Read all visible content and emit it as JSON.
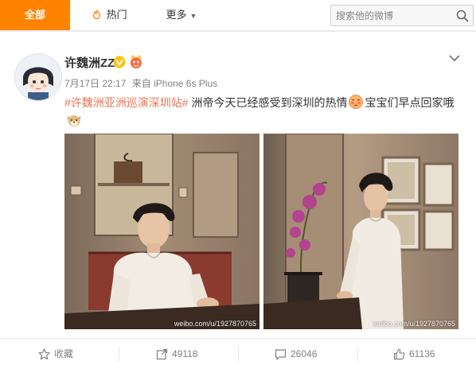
{
  "tabs": {
    "all": "全部",
    "hot": "热门",
    "more": "更多"
  },
  "search": {
    "placeholder": "搜索他的微博"
  },
  "post": {
    "username": "许魏洲ZZ",
    "time": "7月17日 22:17",
    "from_label": "来自",
    "device": "iPhone 6s Plus",
    "hashtag": "#许魏洲亚洲巡演深圳站#",
    "text_part1": " 洲帝今天已经感受到深圳的热情",
    "text_part2": "宝宝们早点回家哦",
    "images": [
      {
        "watermark": "weibo.com/u/1927870765"
      },
      {
        "watermark": "weibo.com/u/1927870765"
      }
    ]
  },
  "actions": {
    "favorite": "收藏",
    "forward_count": "49118",
    "comment_count": "26046",
    "like_count": "61136"
  },
  "colors": {
    "accent": "#ff8200",
    "link": "#eb7350",
    "muted": "#808080",
    "verified": "#ffc300"
  }
}
